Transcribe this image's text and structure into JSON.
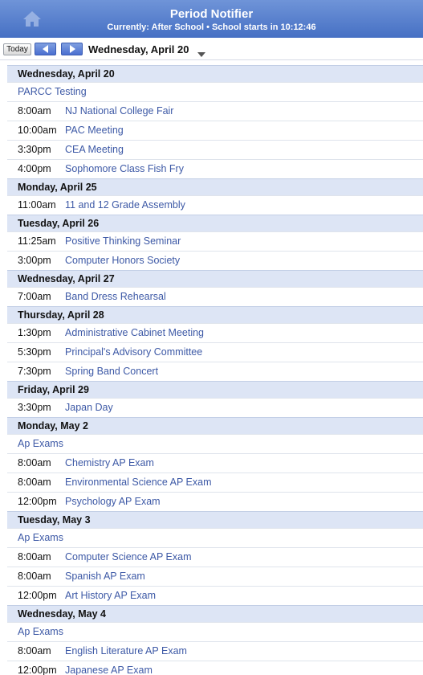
{
  "header": {
    "title": "Period Notifier",
    "subtitle": "Currently: After School • School starts in 10:12:46"
  },
  "toolbar": {
    "today_label": "Today",
    "date_label": "Wednesday, April 20"
  },
  "days": [
    {
      "header": "Wednesday, April 20",
      "events": [
        {
          "time": "",
          "title": "PARCC Testing"
        },
        {
          "time": "8:00am",
          "title": "NJ National College Fair"
        },
        {
          "time": "10:00am",
          "title": "PAC Meeting"
        },
        {
          "time": "3:30pm",
          "title": "CEA Meeting"
        },
        {
          "time": "4:00pm",
          "title": "Sophomore Class Fish Fry"
        }
      ]
    },
    {
      "header": "Monday, April 25",
      "events": [
        {
          "time": "11:00am",
          "title": "11 and 12 Grade Assembly"
        }
      ]
    },
    {
      "header": "Tuesday, April 26",
      "events": [
        {
          "time": "11:25am",
          "title": "Positive Thinking Seminar"
        },
        {
          "time": "3:00pm",
          "title": "Computer Honors Society"
        }
      ]
    },
    {
      "header": "Wednesday, April 27",
      "events": [
        {
          "time": "7:00am",
          "title": "Band Dress Rehearsal"
        }
      ]
    },
    {
      "header": "Thursday, April 28",
      "events": [
        {
          "time": "1:30pm",
          "title": "Administrative Cabinet Meeting"
        },
        {
          "time": "5:30pm",
          "title": "Principal's Advisory Committee"
        },
        {
          "time": "7:30pm",
          "title": "Spring Band Concert"
        }
      ]
    },
    {
      "header": "Friday, April 29",
      "events": [
        {
          "time": "3:30pm",
          "title": "Japan Day"
        }
      ]
    },
    {
      "header": "Monday, May 2",
      "events": [
        {
          "time": "",
          "title": "Ap Exams"
        },
        {
          "time": "8:00am",
          "title": "Chemistry AP Exam"
        },
        {
          "time": "8:00am",
          "title": "Environmental Science AP Exam"
        },
        {
          "time": "12:00pm",
          "title": "Psychology AP Exam"
        }
      ]
    },
    {
      "header": "Tuesday, May 3",
      "events": [
        {
          "time": "",
          "title": "Ap Exams"
        },
        {
          "time": "8:00am",
          "title": "Computer Science AP Exam"
        },
        {
          "time": "8:00am",
          "title": "Spanish AP Exam"
        },
        {
          "time": "12:00pm",
          "title": "Art History AP Exam"
        }
      ]
    },
    {
      "header": "Wednesday, May 4",
      "events": [
        {
          "time": "",
          "title": "Ap Exams"
        },
        {
          "time": "8:00am",
          "title": "English Literature AP Exam"
        },
        {
          "time": "12:00pm",
          "title": "Japanese AP Exam"
        }
      ]
    }
  ]
}
